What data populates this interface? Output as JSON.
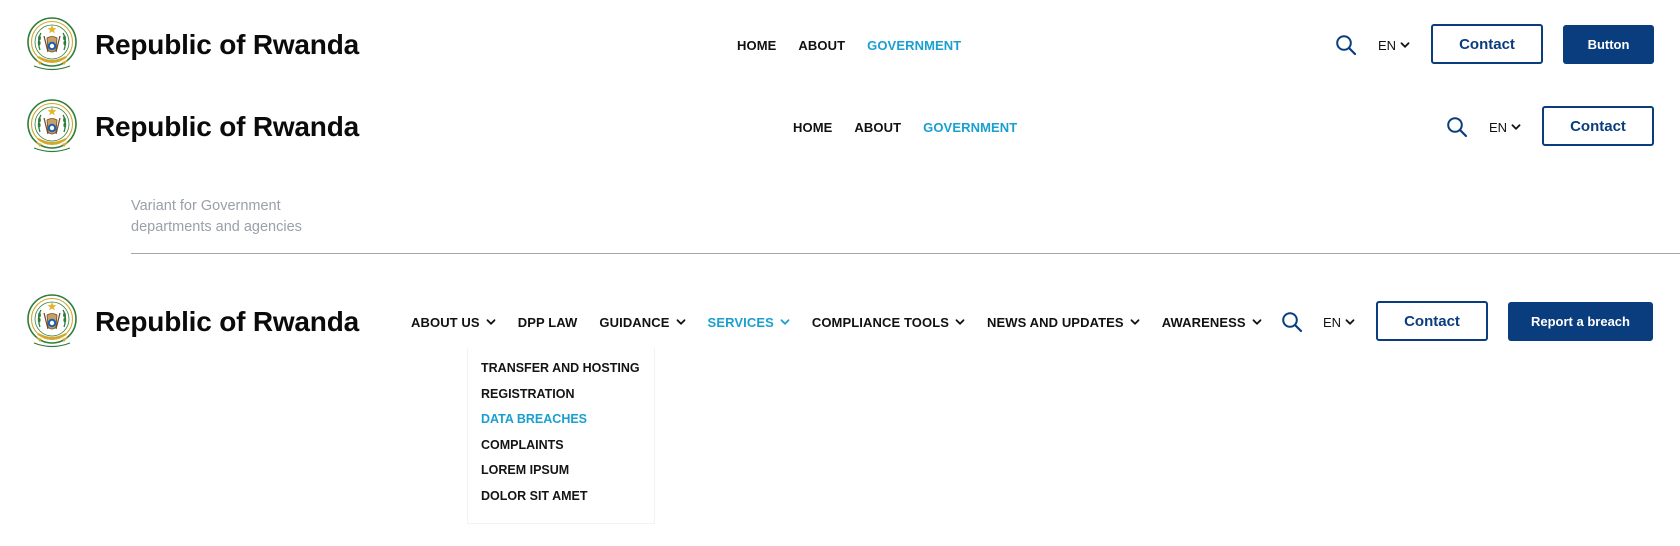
{
  "brand": {
    "title": "Republic of Rwanda"
  },
  "colors": {
    "primary": "#0a3d7e",
    "accent": "#1aa0d0",
    "text": "#0b0b0b",
    "muted": "#9a9fa8"
  },
  "icons": {
    "search": "search-icon",
    "chevron": "chevron-down-icon",
    "seal": "rwanda-seal-icon"
  },
  "header1": {
    "nav": [
      {
        "label": "HOME",
        "active": false
      },
      {
        "label": "ABOUT",
        "active": false
      },
      {
        "label": "GOVERNMENT",
        "active": true
      }
    ],
    "lang": "EN",
    "contact_label": "Contact",
    "button_label": "Button"
  },
  "header2": {
    "nav": [
      {
        "label": "HOME",
        "active": false
      },
      {
        "label": "ABOUT",
        "active": false
      },
      {
        "label": "GOVERNMENT",
        "active": true
      }
    ],
    "lang": "EN",
    "contact_label": "Contact"
  },
  "variant_note": {
    "line1": "Variant for Government",
    "line2": "departments and agencies"
  },
  "header3": {
    "nav": [
      {
        "label": "ABOUT US",
        "active": false,
        "dropdown": true
      },
      {
        "label": "DPP LAW",
        "active": false,
        "dropdown": false
      },
      {
        "label": "GUIDANCE",
        "active": false,
        "dropdown": true
      },
      {
        "label": "SERVICES",
        "active": true,
        "dropdown": true
      },
      {
        "label": "COMPLIANCE TOOLS",
        "active": false,
        "dropdown": true
      },
      {
        "label": "NEWS AND UPDATES",
        "active": false,
        "dropdown": true
      },
      {
        "label": "AWARENESS",
        "active": false,
        "dropdown": true
      }
    ],
    "lang": "EN",
    "contact_label": "Contact",
    "report_label": "Report a breach",
    "services_dropdown": [
      {
        "label": "TRANSFER AND HOSTING",
        "active": false
      },
      {
        "label": "REGISTRATION",
        "active": false
      },
      {
        "label": "DATA BREACHES",
        "active": true
      },
      {
        "label": "COMPLAINTS",
        "active": false
      },
      {
        "label": "LOREM IPSUM",
        "active": false
      },
      {
        "label": "DOLOR SIT AMET",
        "active": false
      }
    ]
  }
}
